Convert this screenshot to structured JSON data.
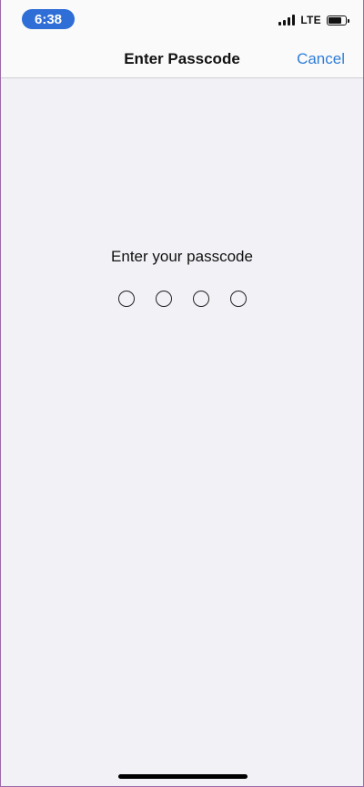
{
  "status_bar": {
    "time": "6:38",
    "network": "LTE",
    "signal_bars": 4,
    "battery_level": 0.85,
    "time_pill_color": "#2f6ed6"
  },
  "nav": {
    "title": "Enter Passcode",
    "cancel_label": "Cancel",
    "cancel_color": "#2f7ed8"
  },
  "passcode": {
    "prompt": "Enter your passcode",
    "digit_count": 4,
    "entered_count": 0
  }
}
